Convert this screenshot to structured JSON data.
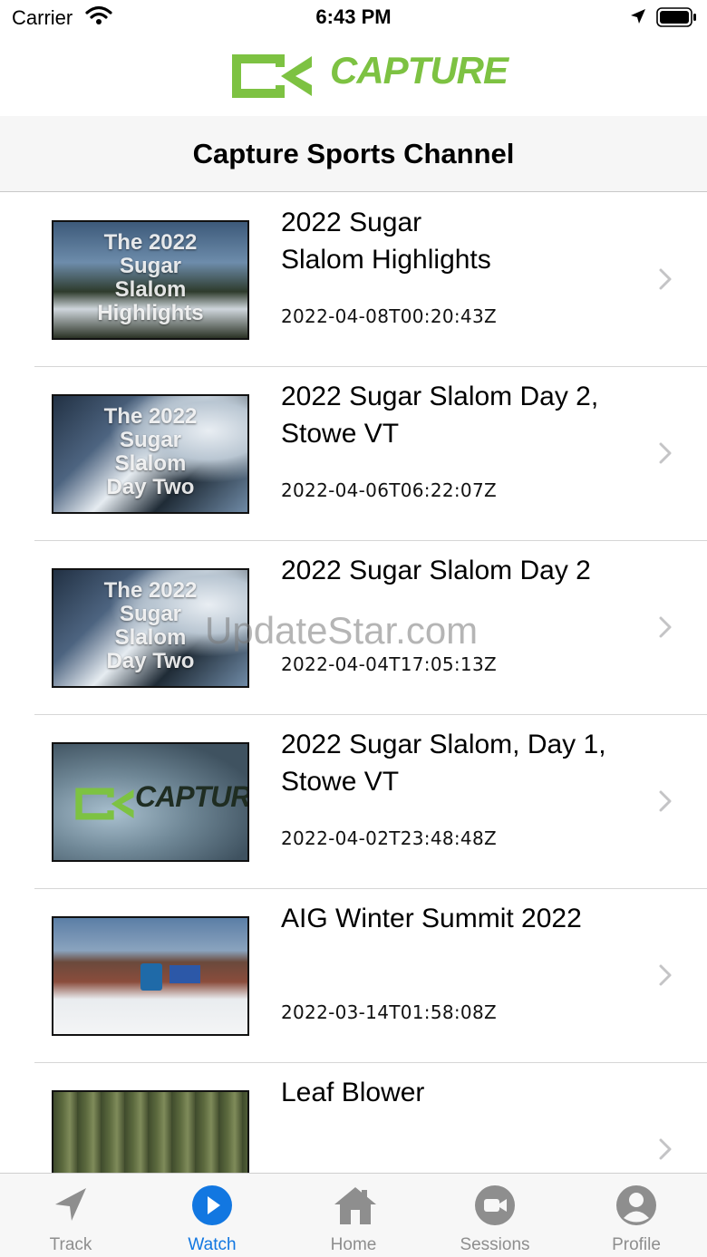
{
  "status_bar": {
    "carrier": "Carrier",
    "time": "6:43 PM"
  },
  "brand": {
    "name": "CAPTURE",
    "color": "#7dc242"
  },
  "nav": {
    "title": "Capture Sports Channel"
  },
  "videos": [
    {
      "title": "2022 Sugar\nSlalom Highlights",
      "date": "2022-04-08T00:20:43Z",
      "thumb_text": "The 2022\nSugar\nSlalom\nHighlights"
    },
    {
      "title": "2022 Sugar Slalom Day 2,\nStowe VT",
      "date": "2022-04-06T06:22:07Z",
      "thumb_text": "The 2022\nSugar\nSlalom\nDay Two"
    },
    {
      "title": "2022 Sugar Slalom Day 2",
      "date": "2022-04-04T17:05:13Z",
      "thumb_text": "The 2022\nSugar\nSlalom\nDay Two"
    },
    {
      "title": "2022 Sugar Slalom, Day 1,\nStowe VT",
      "date": "2022-04-02T23:48:48Z",
      "thumb_text": "CAPTURE"
    },
    {
      "title": "AIG Winter Summit 2022",
      "date": "2022-03-14T01:58:08Z",
      "thumb_text": ""
    },
    {
      "title": "Leaf Blower",
      "date": "",
      "thumb_text": ""
    }
  ],
  "watermark": "UpdateStar.com",
  "tabs": [
    {
      "label": "Track",
      "icon": "location-arrow-icon"
    },
    {
      "label": "Watch",
      "icon": "play-circle-icon"
    },
    {
      "label": "Home",
      "icon": "house-icon"
    },
    {
      "label": "Sessions",
      "icon": "video-camera-icon"
    },
    {
      "label": "Profile",
      "icon": "person-circle-icon"
    }
  ],
  "active_tab": "Watch",
  "colors": {
    "accent": "#1277e1",
    "inactive": "#8e8e8e"
  }
}
